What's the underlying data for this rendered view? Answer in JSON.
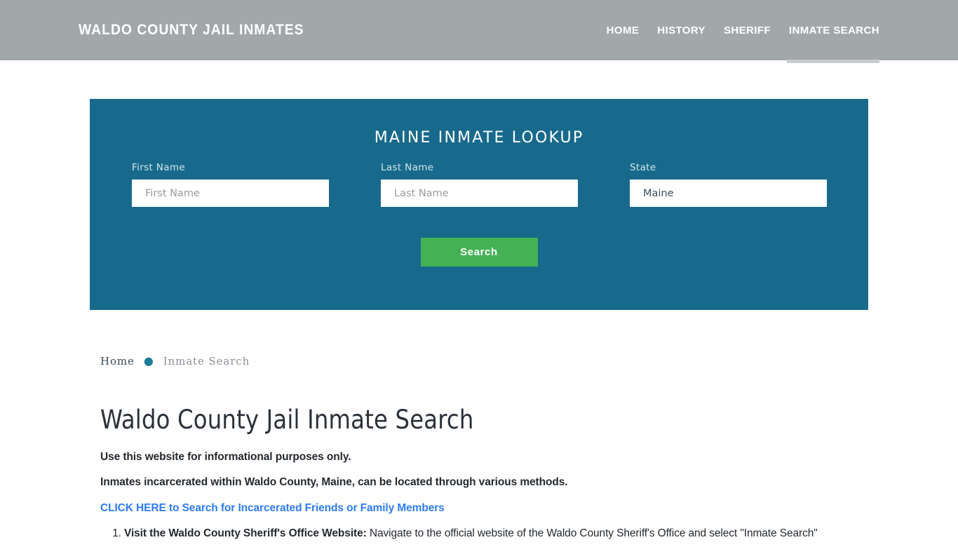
{
  "header": {
    "brand": "WALDO COUNTY JAIL INMATES",
    "nav": [
      {
        "label": "HOME",
        "active": false
      },
      {
        "label": "HISTORY",
        "active": false
      },
      {
        "label": "SHERIFF",
        "active": false
      },
      {
        "label": "INMATE SEARCH",
        "active": true
      }
    ],
    "bg_color": "#a2a7aa",
    "active_underline_color": "#c9cccd"
  },
  "lookup": {
    "title": "MAINE INMATE LOOKUP",
    "panel_color": "#186a8c",
    "fields": {
      "first_name": {
        "label": "First Name",
        "value": "",
        "placeholder": "First Name"
      },
      "last_name": {
        "label": "Last Name",
        "value": "",
        "placeholder": "Last Name"
      },
      "state": {
        "label": "State",
        "value": "Maine",
        "options": [
          "Maine"
        ]
      }
    },
    "search_button": {
      "label": "Search",
      "color": "#45b155"
    }
  },
  "breadcrumb": {
    "home": "Home",
    "separator": "●",
    "current": "Inmate Search",
    "separator_color": "#1c7b99"
  },
  "main": {
    "page_title": "Waldo County Jail Inmate Search",
    "paragraph_1": "Use this website for informational purposes only.",
    "paragraph_2": "Inmates incarcerated within Waldo County, Maine, can be located through various methods.",
    "cta_link": {
      "text": "CLICK HERE to Search for Incarcerated Friends or Family Members",
      "color": "#2e7bef"
    },
    "steps": [
      {
        "heading": "Visit the Waldo County Sheriff's Office Website:",
        "body": " Navigate to the official website of the Waldo County Sheriff's Office and select \"Inmate Search\""
      }
    ]
  }
}
